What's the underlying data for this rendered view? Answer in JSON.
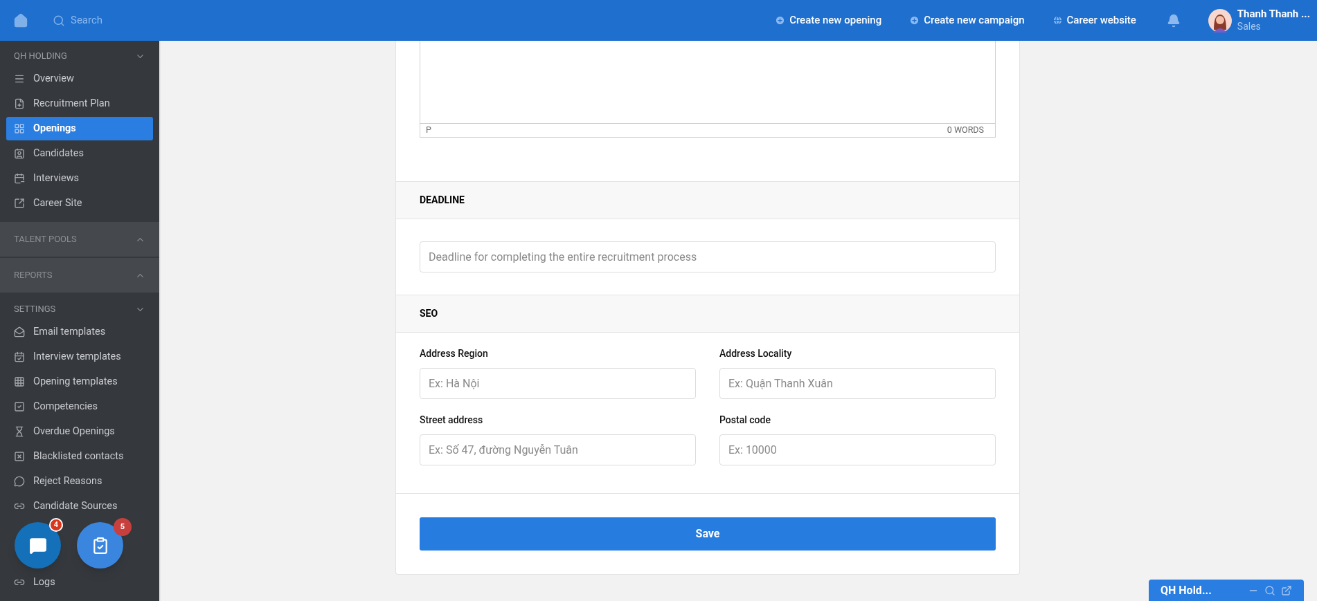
{
  "topbar": {
    "search": {
      "placeholder": "Search"
    },
    "actions": [
      {
        "label": "Create new opening",
        "kind": "plus"
      },
      {
        "label": "Create new campaign",
        "kind": "plus"
      },
      {
        "label": "Career website",
        "kind": "globe"
      }
    ],
    "user": {
      "name": "Thanh Thanh ...",
      "role": "Sales"
    }
  },
  "sidebar": {
    "sections": [
      {
        "title": "QH HOLDING",
        "expanded": true,
        "items": [
          {
            "label": "Overview",
            "selected": false
          },
          {
            "label": "Recruitment Plan",
            "selected": false
          },
          {
            "label": "Openings",
            "selected": true
          },
          {
            "label": "Candidates",
            "selected": false
          },
          {
            "label": "Interviews",
            "selected": false
          },
          {
            "label": "Career Site",
            "selected": false
          }
        ]
      },
      {
        "title": "TALENT POOLS",
        "expanded": false
      },
      {
        "title": "REPORTS",
        "expanded": false
      },
      {
        "title": "SETTINGS",
        "expanded": true,
        "items": [
          {
            "label": "Email templates",
            "selected": false
          },
          {
            "label": "Interview templates",
            "selected": false
          },
          {
            "label": "Opening templates",
            "selected": false
          },
          {
            "label": "Competencies",
            "selected": false
          },
          {
            "label": "Overdue Openings",
            "selected": false
          },
          {
            "label": "Blacklisted contacts",
            "selected": false
          },
          {
            "label": "Reject Reasons",
            "selected": false
          },
          {
            "label": "Candidate Sources",
            "selected": false
          },
          {
            "label": "Logs",
            "selected": false
          }
        ]
      }
    ]
  },
  "editor": {
    "element_path": "P",
    "word_count": "0 WORDS"
  },
  "deadline": {
    "title": "DEADLINE",
    "field": {
      "placeholder": "Deadline for completing the entire recruitment process"
    }
  },
  "seo": {
    "title": "SEO",
    "fields": [
      {
        "label": "Address Region",
        "placeholder": "Ex: Hà Nội"
      },
      {
        "label": "Address Locality",
        "placeholder": "Ex: Quận Thanh Xuân"
      },
      {
        "label": "Street address",
        "placeholder": "Ex: Số 47, đường Nguyễn Tuân"
      },
      {
        "label": "Postal code",
        "placeholder": "Ex: 10000"
      }
    ]
  },
  "save_button": "Save",
  "floating_buttons": [
    {
      "kind": "chat",
      "badge": "4"
    },
    {
      "kind": "tasks",
      "badge": "5"
    }
  ],
  "chat_widget": {
    "title": "QH Hold..."
  }
}
